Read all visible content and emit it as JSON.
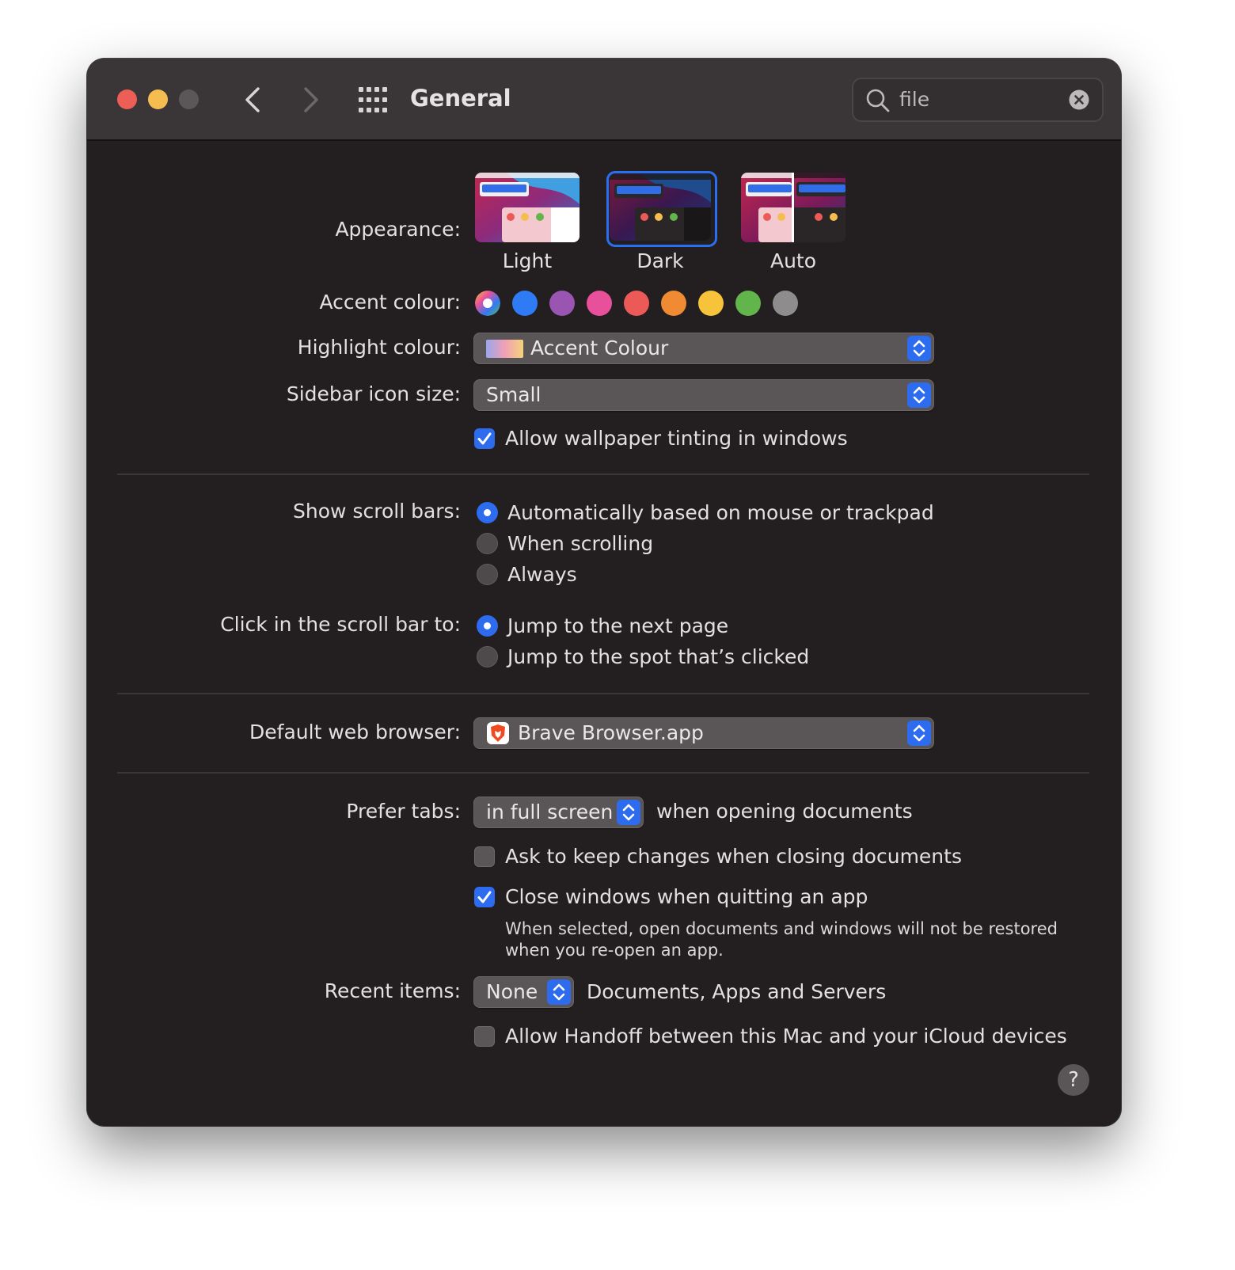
{
  "window": {
    "title": "General",
    "search": {
      "value": "file"
    }
  },
  "appearance": {
    "label": "Appearance:",
    "options": [
      {
        "name": "Light",
        "selected": false
      },
      {
        "name": "Dark",
        "selected": true
      },
      {
        "name": "Auto",
        "selected": false
      }
    ]
  },
  "accent": {
    "label": "Accent colour:",
    "colors": [
      "multicolor",
      "#2f7bf5",
      "#9a55b2",
      "#e9509b",
      "#ec5a58",
      "#f08a33",
      "#f7c33a",
      "#62b54a",
      "#8e8c8d"
    ],
    "selected_index": 0
  },
  "highlight": {
    "label": "Highlight colour:",
    "value": "Accent Colour"
  },
  "sidebar_icon_size": {
    "label": "Sidebar icon size:",
    "value": "Small"
  },
  "wallpaper_tinting": {
    "label": "Allow wallpaper tinting in windows",
    "checked": true
  },
  "scroll_bars": {
    "label": "Show scroll bars:",
    "options": [
      "Automatically based on mouse or trackpad",
      "When scrolling",
      "Always"
    ],
    "selected_index": 0
  },
  "scroll_click": {
    "label": "Click in the scroll bar to:",
    "options": [
      "Jump to the next page",
      "Jump to the spot that’s clicked"
    ],
    "selected_index": 0
  },
  "browser": {
    "label": "Default web browser:",
    "value": "Brave Browser.app"
  },
  "prefer_tabs": {
    "label": "Prefer tabs:",
    "value": "in full screen",
    "suffix": "when opening documents"
  },
  "ask_keep_changes": {
    "label": "Ask to keep changes when closing documents",
    "checked": false
  },
  "close_windows": {
    "label": "Close windows when quitting an app",
    "checked": true,
    "note_line1": "When selected, open documents and windows will not be restored",
    "note_line2": "when you re-open an app."
  },
  "recent_items": {
    "label": "Recent items:",
    "value": "None",
    "suffix": "Documents, Apps and Servers"
  },
  "handoff": {
    "label": "Allow Handoff between this Mac and your iCloud devices",
    "checked": false
  },
  "help": {
    "glyph": "?"
  },
  "colors": {
    "accent_blue": "#2d6bef",
    "window_bg": "#231f20",
    "titlebar_bg": "#3a3638"
  }
}
